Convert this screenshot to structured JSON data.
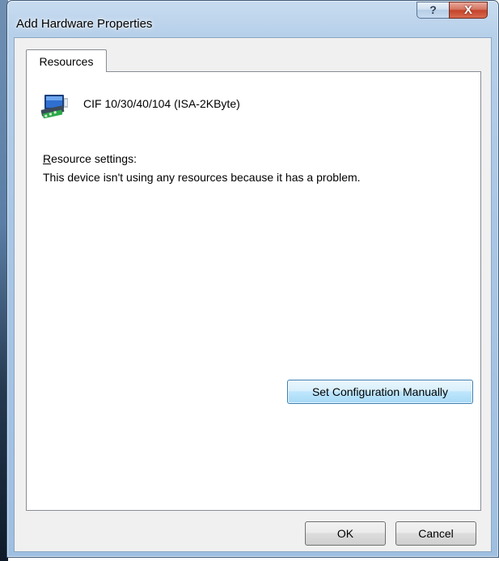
{
  "window": {
    "title": "Add Hardware Properties",
    "help_button_label": "?",
    "close_button_label": "X"
  },
  "tabs": [
    {
      "label": "Resources",
      "selected": true
    }
  ],
  "device": {
    "icon": "network-adapter-icon",
    "name": "CIF 10/30/40/104 (ISA-2KByte)"
  },
  "resources": {
    "settings_label_accesskey": "R",
    "settings_label_rest": "esource settings:",
    "message": "This device isn't using any resources because it has a problem."
  },
  "buttons": {
    "set_configuration": "Set Configuration Manually",
    "ok": "OK",
    "cancel": "Cancel"
  },
  "colors": {
    "titlebar": "#a9c6e5",
    "close_button": "#c5432a",
    "focused_button": "#bee6fd",
    "client_background": "#f0f0f0"
  }
}
